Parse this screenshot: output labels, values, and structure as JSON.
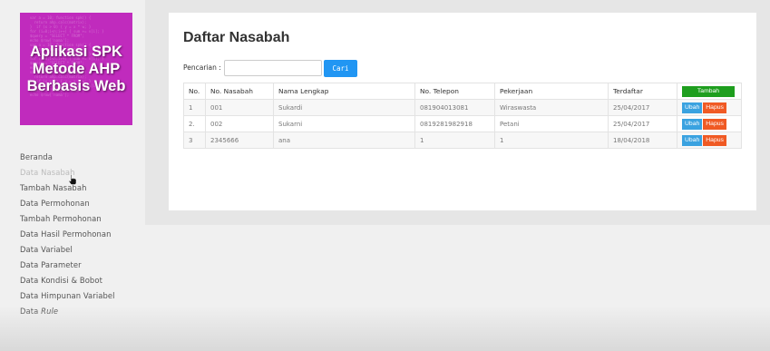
{
  "logo": {
    "lines": [
      "Aplikasi SPK",
      "Metode AHP",
      "Berbasis Web"
    ],
    "background": "#c02bbd"
  },
  "nav": {
    "items": [
      {
        "label": "Beranda"
      },
      {
        "label": "Data Nasabah",
        "active": true
      },
      {
        "label": "Tambah Nasabah"
      },
      {
        "label": "Data Permohonan"
      },
      {
        "label": "Tambah Permohonan"
      },
      {
        "label": "Data Hasil Permohonan"
      },
      {
        "label": "Data Variabel"
      },
      {
        "label": "Data Parameter"
      },
      {
        "label": "Data Kondisi & Bobot"
      },
      {
        "label": "Data Himpunan Variabel"
      },
      {
        "label": "Data",
        "italic_suffix": "Rule"
      }
    ]
  },
  "main": {
    "title": "Daftar Nasabah",
    "search": {
      "label": "Pencarian :",
      "value": "",
      "placeholder": "",
      "button": "Cari"
    },
    "table": {
      "headers": [
        "No.",
        "No. Nasabah",
        "Nama Lengkap",
        "No. Telepon",
        "Pekerjaan",
        "Terdaftar"
      ],
      "add_button": "Tambah",
      "edit_label": "Ubah",
      "delete_label": "Hapus",
      "rows": [
        [
          "1",
          "001",
          "Sukardi",
          "081904013081",
          "Wiraswasta",
          "25/04/2017"
        ],
        [
          "2.",
          "002",
          "Sukarni",
          "0819281982918",
          "Petani",
          "25/04/2017"
        ],
        [
          "3",
          "2345666",
          "ana",
          "1",
          "1",
          "18/04/2018"
        ]
      ]
    }
  },
  "colors": {
    "accent_blue": "#2196f3",
    "add_green": "#1e9e1e",
    "edit_blue": "#3aa2e0",
    "delete_orange": "#f05a24"
  }
}
